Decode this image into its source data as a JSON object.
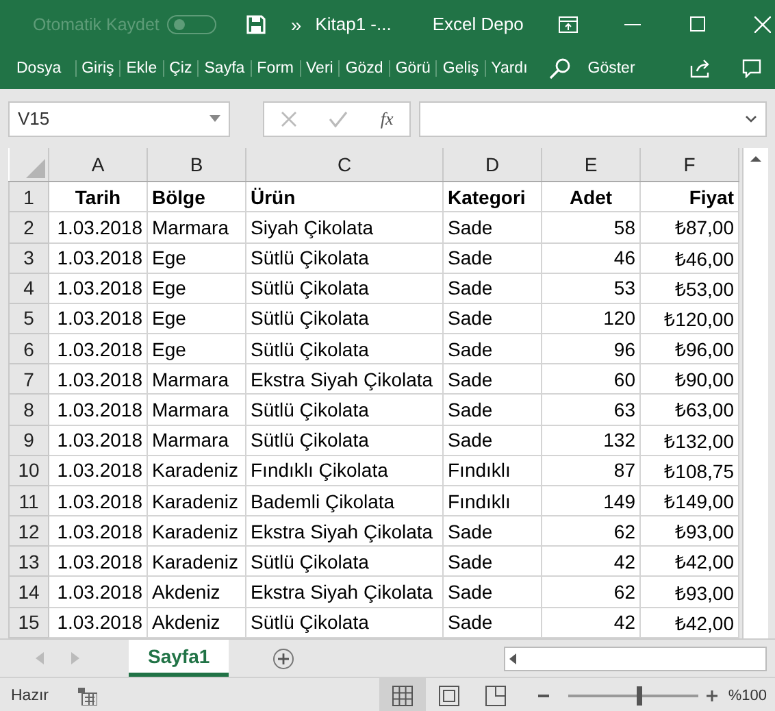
{
  "title_bar": {
    "autosave": {
      "label": "Otomatik Kaydet",
      "on": false
    },
    "quick_access": "»",
    "document": "Kitap1  -...",
    "user": "Excel Depo"
  },
  "ribbon_tabs": [
    {
      "label": "Dosya"
    },
    {
      "label": "Giriş"
    },
    {
      "label": "Ekle"
    },
    {
      "label": "Çiz"
    },
    {
      "label": "Sayfa"
    },
    {
      "label": "Form"
    },
    {
      "label": "Veri"
    },
    {
      "label": "Gözd"
    },
    {
      "label": "Görü"
    },
    {
      "label": "Geliş"
    },
    {
      "label": "Yardı"
    }
  ],
  "tell_me": "Göster",
  "formula_bar": {
    "name_box": "V15",
    "fx": "fx"
  },
  "columns": [
    "A",
    "B",
    "C",
    "D",
    "E",
    "F"
  ],
  "rows": [
    {
      "n": "1",
      "cells": [
        "Tarih",
        "Bölge",
        "Ürün",
        "Kategori",
        "Adet",
        "Fiyat"
      ]
    },
    {
      "n": "2",
      "cells": [
        "1.03.2018",
        "Marmara",
        "Siyah Çikolata",
        "Sade",
        "58",
        "₺87,00"
      ]
    },
    {
      "n": "3",
      "cells": [
        "1.03.2018",
        "Ege",
        "Sütlü Çikolata",
        "Sade",
        "46",
        "₺46,00"
      ]
    },
    {
      "n": "4",
      "cells": [
        "1.03.2018",
        "Ege",
        "Sütlü Çikolata",
        "Sade",
        "53",
        "₺53,00"
      ]
    },
    {
      "n": "5",
      "cells": [
        "1.03.2018",
        "Ege",
        "Sütlü Çikolata",
        "Sade",
        "120",
        "₺120,00"
      ]
    },
    {
      "n": "6",
      "cells": [
        "1.03.2018",
        "Ege",
        "Sütlü Çikolata",
        "Sade",
        "96",
        "₺96,00"
      ]
    },
    {
      "n": "7",
      "cells": [
        "1.03.2018",
        "Marmara",
        "Ekstra Siyah Çikolata",
        "Sade",
        "60",
        "₺90,00"
      ]
    },
    {
      "n": "8",
      "cells": [
        "1.03.2018",
        "Marmara",
        "Sütlü Çikolata",
        "Sade",
        "63",
        "₺63,00"
      ]
    },
    {
      "n": "9",
      "cells": [
        "1.03.2018",
        "Marmara",
        "Sütlü Çikolata",
        "Sade",
        "132",
        "₺132,00"
      ]
    },
    {
      "n": "10",
      "cells": [
        "1.03.2018",
        "Karadeniz",
        "Fındıklı Çikolata",
        "Fındıklı",
        "87",
        "₺108,75"
      ]
    },
    {
      "n": "11",
      "cells": [
        "1.03.2018",
        "Karadeniz",
        "Bademli Çikolata",
        "Fındıklı",
        "149",
        "₺149,00"
      ]
    },
    {
      "n": "12",
      "cells": [
        "1.03.2018",
        "Karadeniz",
        "Ekstra Siyah Çikolata",
        "Sade",
        "62",
        "₺93,00"
      ]
    },
    {
      "n": "13",
      "cells": [
        "1.03.2018",
        "Karadeniz",
        "Sütlü Çikolata",
        "Sade",
        "42",
        "₺42,00"
      ]
    },
    {
      "n": "14",
      "cells": [
        "1.03.2018",
        "Akdeniz",
        "Ekstra Siyah Çikolata",
        "Sade",
        "62",
        "₺93,00"
      ]
    },
    {
      "n": "15",
      "cells": [
        "1.03.2018",
        "Akdeniz",
        "Sütlü Çikolata",
        "Sade",
        "42",
        "₺42,00"
      ]
    }
  ],
  "sheet_tabs": [
    {
      "label": "Sayfa1",
      "selected": true
    }
  ],
  "status_bar": {
    "text": "Hazır",
    "views": [
      {
        "kind": "normal",
        "selected": true
      },
      {
        "kind": "layout",
        "selected": false
      },
      {
        "kind": "pagebreak",
        "selected": false
      }
    ],
    "zoom": {
      "level": 0.55,
      "reading": "%100"
    }
  }
}
